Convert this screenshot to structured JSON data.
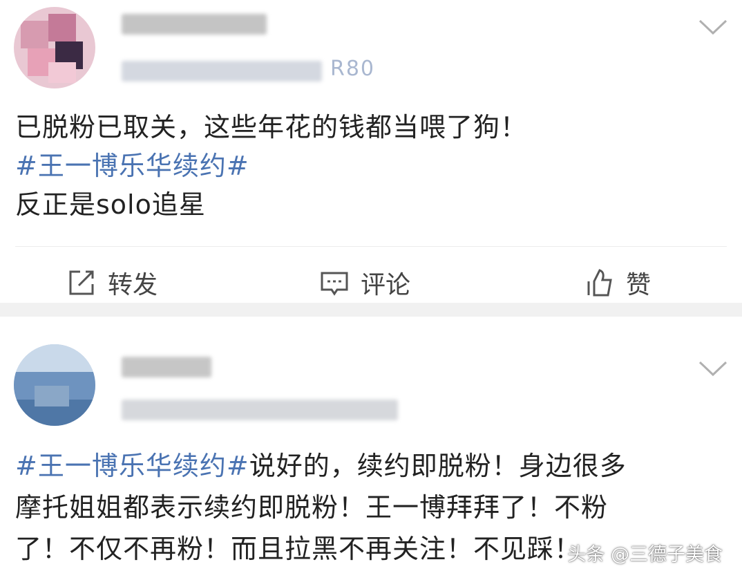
{
  "posts": [
    {
      "meta_visible": "R80",
      "body_line1": "已脱粉已取关，这些年花的钱都当喂了狗！",
      "hashtag": "#王一博乐华续约#",
      "body_line3": "反正是solo追星",
      "actions": {
        "repost": "转发",
        "comment": "评论",
        "like": "赞"
      }
    },
    {
      "hashtag": "#王一博乐华续约#",
      "line1_rest": "说好的，续约即脱粉！身边很多",
      "line2": "摩托姐姐都表示续约即脱粉！王一博拜拜了！不粉",
      "line3": "了！不仅不再粉！而且拉黑不再关注！不见踩！"
    }
  ],
  "watermark": "头条 @三德子美食",
  "colors": {
    "hashtag": "#4a73b2",
    "separator": "#f1f1f1"
  },
  "icons": [
    "chevron-down-icon",
    "repost-icon",
    "comment-icon",
    "like-icon"
  ]
}
